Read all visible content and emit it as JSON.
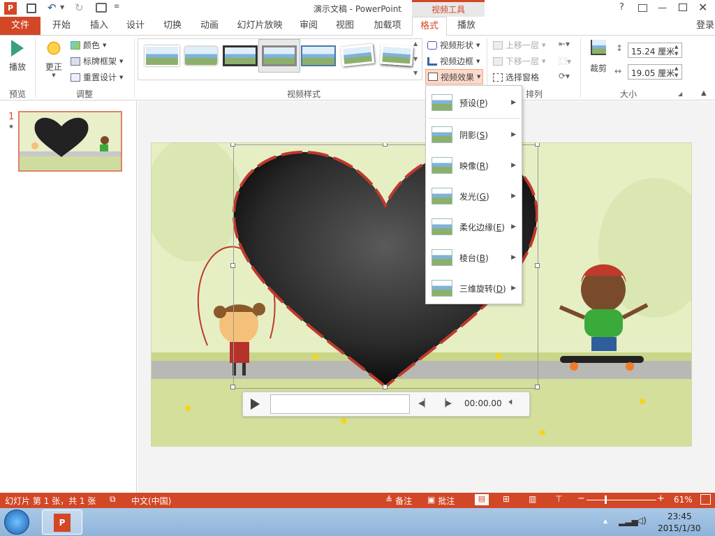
{
  "window": {
    "title": "演示文稿 - PowerPoint",
    "context_tab_group": "视频工具",
    "help": "?",
    "login": "登录"
  },
  "tabs": [
    "开始",
    "插入",
    "设计",
    "切换",
    "动画",
    "幻灯片放映",
    "审阅",
    "视图",
    "加载项",
    "格式",
    "播放"
  ],
  "file_tab": "文件",
  "ribbon": {
    "play": "播放",
    "correct": "更正",
    "color": "颜色",
    "poster_frame": "标牌框架",
    "reset_design": "重置设计",
    "video_shape": "视频形状",
    "video_border": "视频边框",
    "video_effects": "视频效果",
    "bring_forward": "上移一层",
    "send_backward": "下移一层",
    "selection_pane": "选择窗格",
    "crop": "裁剪",
    "height": "15.24 厘米",
    "width": "19.05 厘米",
    "groups": {
      "preview": "预览",
      "adjust": "调整",
      "video_styles": "视频样式",
      "arrange": "排列",
      "size": "大小"
    }
  },
  "effects_menu": [
    {
      "label": "预设",
      "key": "P"
    },
    {
      "label": "阴影",
      "key": "S"
    },
    {
      "label": "映像",
      "key": "R"
    },
    {
      "label": "发光",
      "key": "G"
    },
    {
      "label": "柔化边缘",
      "key": "E"
    },
    {
      "label": "棱台",
      "key": "B"
    },
    {
      "label": "三维旋转",
      "key": "D"
    }
  ],
  "slide_panel": {
    "number": "1",
    "star": "★"
  },
  "media_controls": {
    "time": "00:00.00"
  },
  "status": {
    "slide_info": "幻灯片 第 1 张，共 1 张",
    "language": "中文(中国)",
    "notes": "备注",
    "comments": "批注",
    "zoom": "61%"
  },
  "taskbar": {
    "time": "23:45",
    "date": "2015/1/30"
  },
  "colors": {
    "accent": "#d24726",
    "ribbon_bg": "#ffffff",
    "slide_bg": "#e6efc4"
  }
}
